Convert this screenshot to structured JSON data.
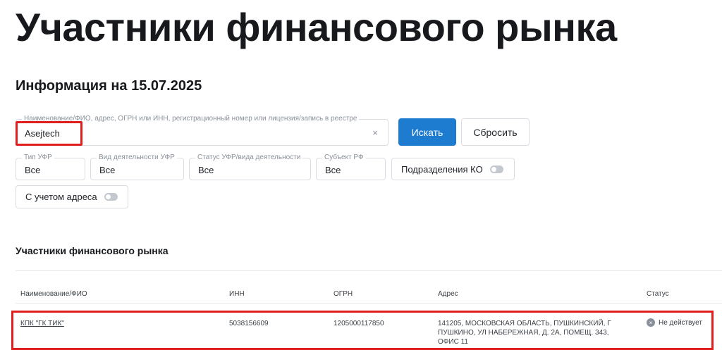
{
  "page": {
    "title": "Участники финансового рынка",
    "info_date": "Информация на 15.07.2025"
  },
  "search": {
    "legend": "Наименование/ФИО, адрес, ОГРН или ИНН, регистрационный номер или лицензия/запись в реестре",
    "value": "Asejtech",
    "clear_icon": "×"
  },
  "buttons": {
    "search_label": "Искать",
    "reset_label": "Сбросить"
  },
  "filters": [
    {
      "legend": "Тип УФР",
      "value": "Все"
    },
    {
      "legend": "Вид деятельности УФР",
      "value": "Все"
    },
    {
      "legend": "Статус УФР/вида деятельности",
      "value": "Все"
    },
    {
      "legend": "Субъект РФ",
      "value": "Все"
    }
  ],
  "toggles": {
    "ko_label": "Подразделения КО",
    "address_label": "С учетом адреса"
  },
  "results": {
    "title": "Участники финансового рынка",
    "columns": [
      "Наименование/ФИО",
      "ИНН",
      "ОГРН",
      "Адрес",
      "Статус"
    ],
    "rows": [
      {
        "name": "КПК \"ГК ТИК\"",
        "inn": "5038156609",
        "ogrn": "1205000117850",
        "address": "141205, МОСКОВСКАЯ ОБЛАСТЬ, ПУШКИНСКИЙ, Г ПУШКИНО, УЛ НАБЕРЕЖНАЯ, Д. 2А, ПОМЕЩ. 343, ОФИС 11",
        "status": "Не действует",
        "status_icon": "×"
      }
    ]
  },
  "colors": {
    "accent": "#1d7bd0",
    "highlight": "#e01e1e"
  }
}
